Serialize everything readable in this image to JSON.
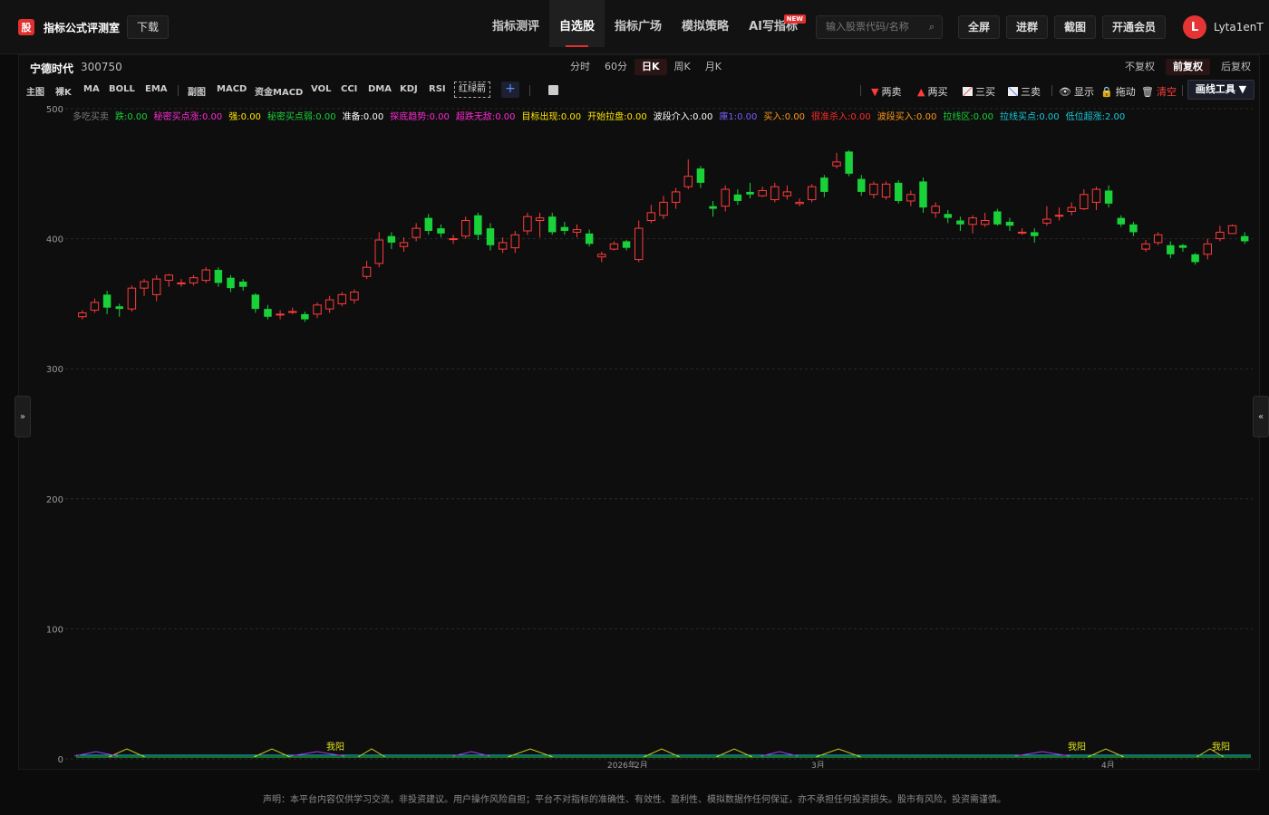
{
  "topbar": {
    "logo_char": "股",
    "brand": "指标公式评测室",
    "download": "下载",
    "nav": [
      {
        "label": "指标测评",
        "active": false
      },
      {
        "label": "自选股",
        "active": true
      },
      {
        "label": "指标广场",
        "active": false
      },
      {
        "label": "模拟策略",
        "active": false
      },
      {
        "label": "AI写指标",
        "active": false,
        "badge": "NEW"
      }
    ],
    "search_placeholder": "输入股票代码/名称",
    "fullscreen": "全屏",
    "join_group": "进群",
    "screenshot": "截图",
    "vip": "开通会员",
    "avatar_letter": "L",
    "username": "Lyta1enT"
  },
  "stock": {
    "name": "宁德时代",
    "code": "300750",
    "periods": [
      {
        "label": "分时",
        "active": false
      },
      {
        "label": "60分",
        "active": false
      },
      {
        "label": "日K",
        "active": true
      },
      {
        "label": "周K",
        "active": false
      },
      {
        "label": "月K",
        "active": false
      }
    ],
    "adjust": [
      {
        "label": "不复权",
        "active": false
      },
      {
        "label": "前复权",
        "active": true
      },
      {
        "label": "后复权",
        "active": false
      }
    ]
  },
  "toolbar": {
    "main_label": "主图",
    "main_items": [
      "裸K",
      "MA",
      "BOLL",
      "EMA"
    ],
    "sub_label": "副图",
    "sub_items": [
      "MACD",
      "资金MACD",
      "VOL",
      "CCI",
      "DMA",
      "KDJ",
      "RSI"
    ],
    "hongluo": "红绿箭",
    "plus": "+",
    "signals": [
      {
        "label": "两卖",
        "icon": "down-triangle-icon",
        "color": "#ff3b3b"
      },
      {
        "label": "两买",
        "icon": "up-triangle-icon",
        "color": "#ff3b3b"
      },
      {
        "label": "三买",
        "icon": "chart-up-icon",
        "color": "#ddd"
      },
      {
        "label": "三卖",
        "icon": "chart-down-icon",
        "color": "#ddd"
      }
    ],
    "show": "显示",
    "drag": "拖动",
    "clear": "清空",
    "draw_tool": "画线工具 ▼"
  },
  "legend": [
    {
      "text": "多吃买卖",
      "color": "#7a7a7a"
    },
    {
      "text": "跌:0.00",
      "color": "#19d23a"
    },
    {
      "text": "秘密买点涨:0.00",
      "color": "#ff2ad4"
    },
    {
      "text": "强:0.00",
      "color": "#ffe600"
    },
    {
      "text": "秘密买点弱:0.00",
      "color": "#19d23a"
    },
    {
      "text": "准备:0.00",
      "color": "#ffffff"
    },
    {
      "text": "探底趋势:0.00",
      "color": "#ff2ad4"
    },
    {
      "text": "超跌无敌:0.00",
      "color": "#ff2ad4"
    },
    {
      "text": "目标出现:0.00",
      "color": "#ffe600"
    },
    {
      "text": "开始拉盘:0.00",
      "color": "#ffe600"
    },
    {
      "text": "波段介入:0.00",
      "color": "#ffffff"
    },
    {
      "text": "庫1:0.00",
      "color": "#7b5cff"
    },
    {
      "text": "买入:0.00",
      "color": "#ff9a1a"
    },
    {
      "text": "很准杀入:0.00",
      "color": "#ff2a2a"
    },
    {
      "text": "波段买入:0.00",
      "color": "#ff9a1a"
    },
    {
      "text": "拉线区:0.00",
      "color": "#19d23a"
    },
    {
      "text": "拉线买点:0.00",
      "color": "#19c9d8"
    },
    {
      "text": "低位超涨:2.00",
      "color": "#19c9d8"
    }
  ],
  "chart_data": {
    "type": "candlestick",
    "ylim": [
      0,
      500
    ],
    "yticks": [
      0,
      100,
      200,
      300,
      400,
      500
    ],
    "x_labels": [
      "2026年",
      "2月",
      "3月",
      "4月"
    ],
    "bottom_marks": [
      "我阳",
      "我阳",
      "我阳"
    ],
    "up_color": "#ff3b3b",
    "down_color": "#19d23a",
    "candles": [
      [
        340,
        343,
        345,
        338
      ],
      [
        345,
        351,
        354,
        343
      ],
      [
        357,
        347,
        360,
        342
      ],
      [
        348,
        346,
        350,
        340
      ],
      [
        346,
        362,
        364,
        344
      ],
      [
        362,
        367,
        369,
        356
      ],
      [
        357,
        369,
        372,
        352
      ],
      [
        368,
        372,
        373,
        363
      ],
      [
        366,
        366,
        369,
        363
      ],
      [
        366,
        370,
        372,
        364
      ],
      [
        368,
        376,
        378,
        366
      ],
      [
        376,
        366,
        378,
        363
      ],
      [
        370,
        362,
        372,
        359
      ],
      [
        367,
        363,
        369,
        360
      ],
      [
        357,
        346,
        358,
        343
      ],
      [
        346,
        340,
        349,
        338
      ],
      [
        342,
        342,
        345,
        338
      ],
      [
        344,
        344,
        347,
        342
      ],
      [
        342,
        338,
        344,
        336
      ],
      [
        342,
        349,
        351,
        339
      ],
      [
        346,
        353,
        356,
        343
      ],
      [
        350,
        357,
        359,
        348
      ],
      [
        353,
        359,
        361,
        350
      ],
      [
        371,
        378,
        383,
        369
      ],
      [
        381,
        399,
        405,
        378
      ],
      [
        402,
        397,
        405,
        392
      ],
      [
        394,
        397,
        401,
        390
      ],
      [
        401,
        408,
        412,
        398
      ],
      [
        416,
        406,
        419,
        403
      ],
      [
        408,
        404,
        411,
        401
      ],
      [
        400,
        400,
        403,
        396
      ],
      [
        402,
        414,
        417,
        400
      ],
      [
        418,
        403,
        420,
        399
      ],
      [
        408,
        395,
        412,
        391
      ],
      [
        392,
        397,
        401,
        389
      ],
      [
        393,
        403,
        406,
        389
      ],
      [
        406,
        417,
        420,
        403
      ],
      [
        414,
        416,
        420,
        401
      ],
      [
        417,
        405,
        420,
        403
      ],
      [
        409,
        406,
        413,
        403
      ],
      [
        405,
        407,
        411,
        401
      ],
      [
        404,
        396,
        407,
        394
      ],
      [
        386,
        388,
        390,
        382
      ],
      [
        392,
        396,
        398,
        391
      ],
      [
        398,
        393,
        399,
        391
      ],
      [
        384,
        408,
        414,
        382
      ],
      [
        414,
        420,
        426,
        412
      ],
      [
        418,
        428,
        433,
        415
      ],
      [
        428,
        436,
        439,
        423
      ],
      [
        440,
        448,
        461,
        438
      ],
      [
        454,
        443,
        456,
        439
      ],
      [
        425,
        423,
        429,
        417
      ],
      [
        425,
        438,
        441,
        421
      ],
      [
        434,
        429,
        438,
        426
      ],
      [
        436,
        434,
        443,
        431
      ],
      [
        433,
        437,
        440,
        432
      ],
      [
        430,
        440,
        443,
        428
      ],
      [
        433,
        436,
        441,
        430
      ],
      [
        427,
        428,
        431,
        425
      ],
      [
        430,
        440,
        442,
        428
      ],
      [
        447,
        436,
        449,
        432
      ],
      [
        456,
        459,
        466,
        454
      ],
      [
        467,
        450,
        468,
        448
      ],
      [
        446,
        436,
        449,
        433
      ],
      [
        434,
        442,
        444,
        431
      ],
      [
        432,
        442,
        444,
        430
      ],
      [
        443,
        429,
        445,
        427
      ],
      [
        429,
        434,
        437,
        425
      ],
      [
        444,
        424,
        447,
        420
      ],
      [
        420,
        425,
        428,
        416
      ],
      [
        419,
        416,
        422,
        412
      ],
      [
        414,
        411,
        417,
        406
      ],
      [
        411,
        416,
        418,
        404
      ],
      [
        411,
        414,
        420,
        409
      ],
      [
        421,
        411,
        423,
        410
      ],
      [
        413,
        410,
        416,
        406
      ],
      [
        405,
        405,
        408,
        403
      ],
      [
        405,
        402,
        408,
        397
      ],
      [
        412,
        415,
        425,
        410
      ],
      [
        418,
        418,
        424,
        414
      ],
      [
        421,
        424,
        428,
        418
      ],
      [
        423,
        434,
        438,
        422
      ],
      [
        428,
        438,
        440,
        422
      ],
      [
        437,
        427,
        441,
        424
      ],
      [
        416,
        411,
        418,
        409
      ],
      [
        411,
        405,
        413,
        402
      ],
      [
        392,
        396,
        399,
        390
      ],
      [
        397,
        403,
        405,
        395
      ],
      [
        395,
        388,
        398,
        385
      ],
      [
        395,
        393,
        396,
        390
      ],
      [
        388,
        382,
        389,
        380
      ],
      [
        388,
        396,
        400,
        384
      ],
      [
        400,
        405,
        410,
        398
      ],
      [
        404,
        410,
        411,
        405
      ],
      [
        402,
        398,
        405,
        396
      ]
    ]
  },
  "footer": "声明：本平台内容仅供学习交流，非投资建议。用户操作风险自担；平台不对指标的准确性、有效性、盈利性、模拟数据作任何保证，亦不承担任何投资损失。股市有风险，投资需谨慎。"
}
